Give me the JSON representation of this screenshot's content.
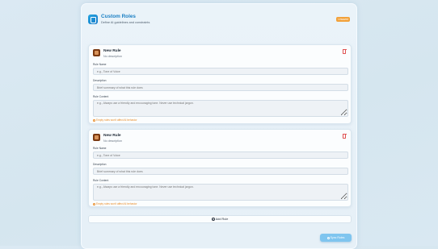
{
  "header": {
    "title": "Custom Roles",
    "subtitle": "Define AI guidelines and constraints",
    "badge": "Unsaved"
  },
  "rules": [
    {
      "name": "New Rule",
      "description_text": "No description",
      "name_label": "Rule Name",
      "name_placeholder": "e.g., Tone of Voice",
      "description_label": "Description",
      "description_placeholder": "Brief summary of what this rule does",
      "content_label": "Rule Content",
      "content_placeholder": "e.g., Always use a friendly and encouraging tone. Never use technical jargon.",
      "warning": "Empty rules won't affect AI behavior"
    },
    {
      "name": "New Rule",
      "description_text": "No description",
      "name_label": "Rule Name",
      "name_placeholder": "e.g., Tone of Voice",
      "description_label": "Description",
      "description_placeholder": "Brief summary of what this rule does",
      "content_label": "Rule Content",
      "content_placeholder": "e.g., Always use a friendly and encouraging tone. Never use technical jargon.",
      "warning": "Empty rules won't affect AI behavior"
    }
  ],
  "actions": {
    "add_rule": "Add Rule",
    "sync": "Sync Roles"
  }
}
